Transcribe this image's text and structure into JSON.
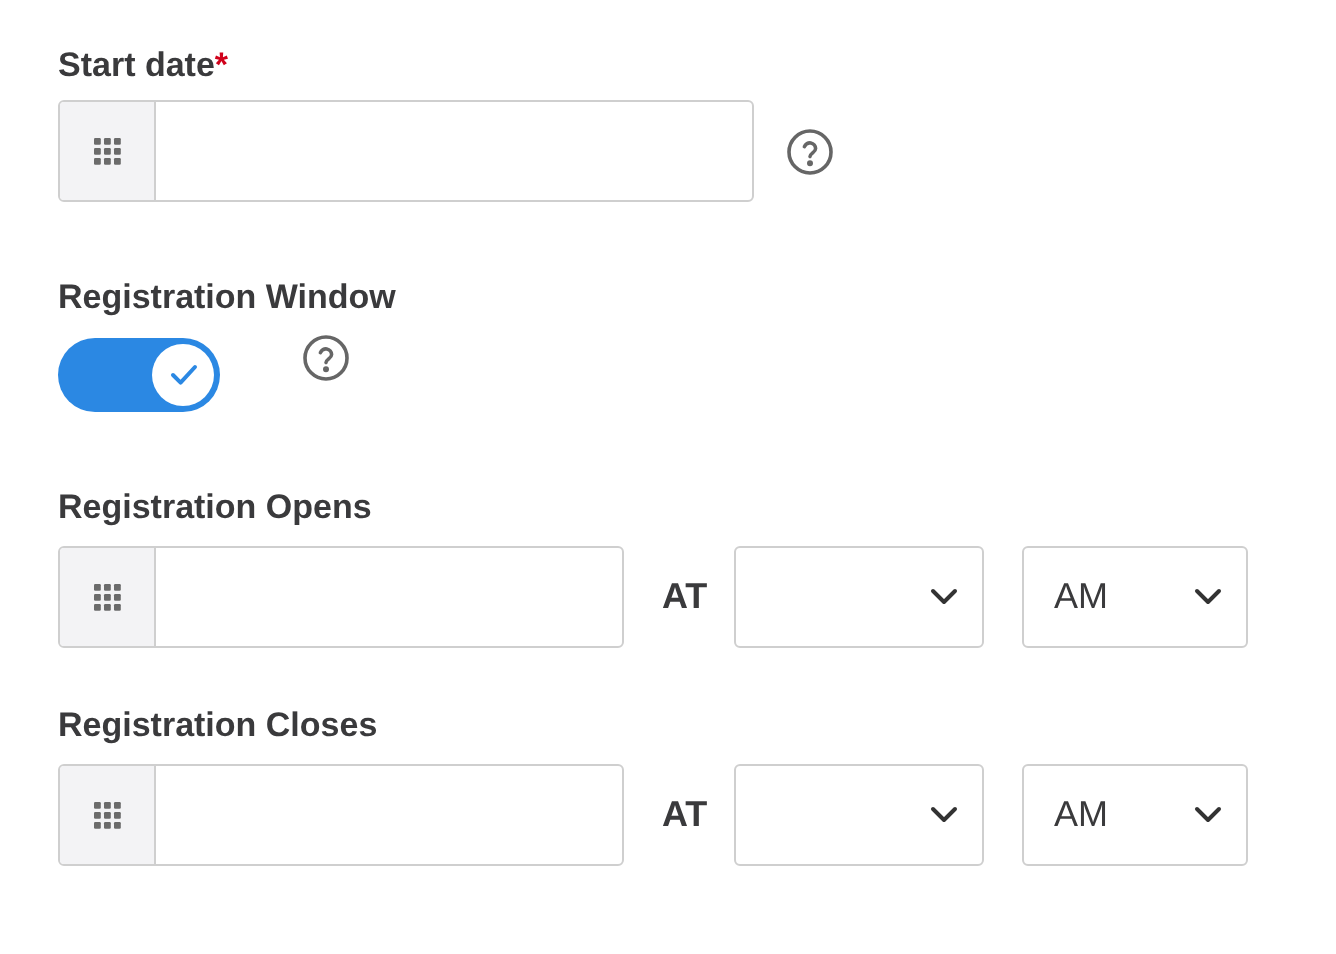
{
  "start_date": {
    "label": "Start date",
    "required_mark": "*"
  },
  "registration_window": {
    "label": "Registration Window",
    "on": true
  },
  "schedule": [
    {
      "label": "Registration Opens",
      "at": "AT",
      "period": "AM"
    },
    {
      "label": "Registration Closes",
      "at": "AT",
      "period": "AM"
    }
  ]
}
